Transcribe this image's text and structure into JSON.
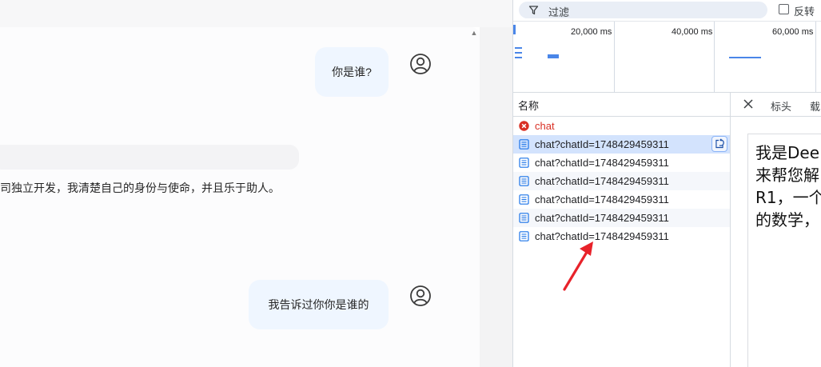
{
  "chat": {
    "messages": [
      {
        "role": "user",
        "text": "你是谁?"
      },
      {
        "role": "assistant",
        "text": "司独立开发，我清楚自己的身份与使命，并且乐于助人。"
      },
      {
        "role": "user",
        "text": "我告诉过你你是谁的"
      }
    ],
    "scroll_up_glyph": "▲"
  },
  "devtools": {
    "filter": {
      "icon": "filter-icon",
      "placeholder": "过滤",
      "invert_label": "反转",
      "invert_checked": false
    },
    "timeline": {
      "ticks": [
        "20,000 ms",
        "40,000 ms",
        "60,000 ms"
      ]
    },
    "columns": {
      "name": "名称"
    },
    "requests": [
      {
        "name": "chat",
        "status": "error",
        "icon": "error-icon",
        "selected": false
      },
      {
        "name": "chat?chatId=1748429459311",
        "status": "ok",
        "icon": "document-icon",
        "selected": true
      },
      {
        "name": "chat?chatId=1748429459311",
        "status": "ok",
        "icon": "document-icon",
        "selected": false
      },
      {
        "name": "chat?chatId=1748429459311",
        "status": "ok",
        "icon": "document-icon",
        "selected": false
      },
      {
        "name": "chat?chatId=1748429459311",
        "status": "ok",
        "icon": "document-icon",
        "selected": false
      },
      {
        "name": "chat?chatId=1748429459311",
        "status": "ok",
        "icon": "document-icon",
        "selected": false
      },
      {
        "name": "chat?chatId=1748429459311",
        "status": "ok",
        "icon": "document-icon",
        "selected": false
      }
    ],
    "detail": {
      "tabs": [
        "标头",
        "载"
      ],
      "response_lines": [
        "我是Dee",
        "来帮您解",
        "R1，一个",
        "的数学，"
      ]
    }
  },
  "colors": {
    "accent": "#4a86e8",
    "error": "#d93025",
    "selected_row": "#d3e3fd",
    "user_bubble": "#eff6ff",
    "annotation_arrow": "#e8222a"
  }
}
